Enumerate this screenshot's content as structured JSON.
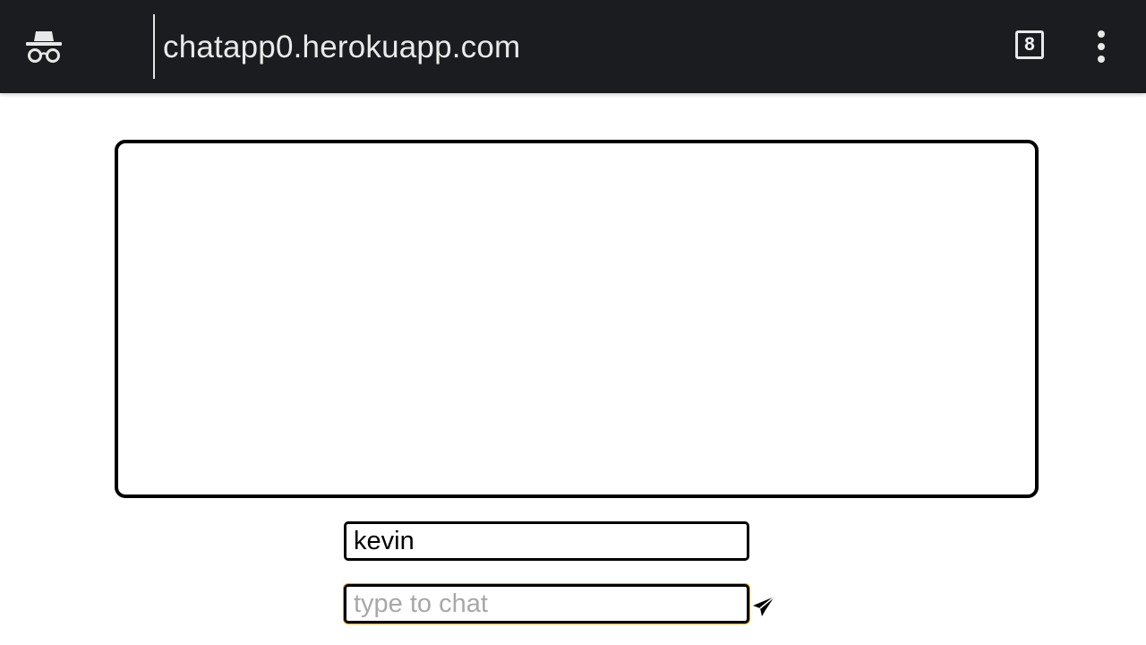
{
  "browser": {
    "url": "chatapp0.herokuapp.com",
    "tab_count": "8",
    "icons": {
      "incognito": "incognito-icon",
      "menu": "more-vert-icon",
      "send": "send-icon"
    }
  },
  "chat": {
    "username_value": "kevin",
    "message_value": "",
    "message_placeholder": "type to chat"
  },
  "colors": {
    "toolbar": "#1a1c20",
    "focus_ring": "#e0a416",
    "border": "#000000"
  }
}
